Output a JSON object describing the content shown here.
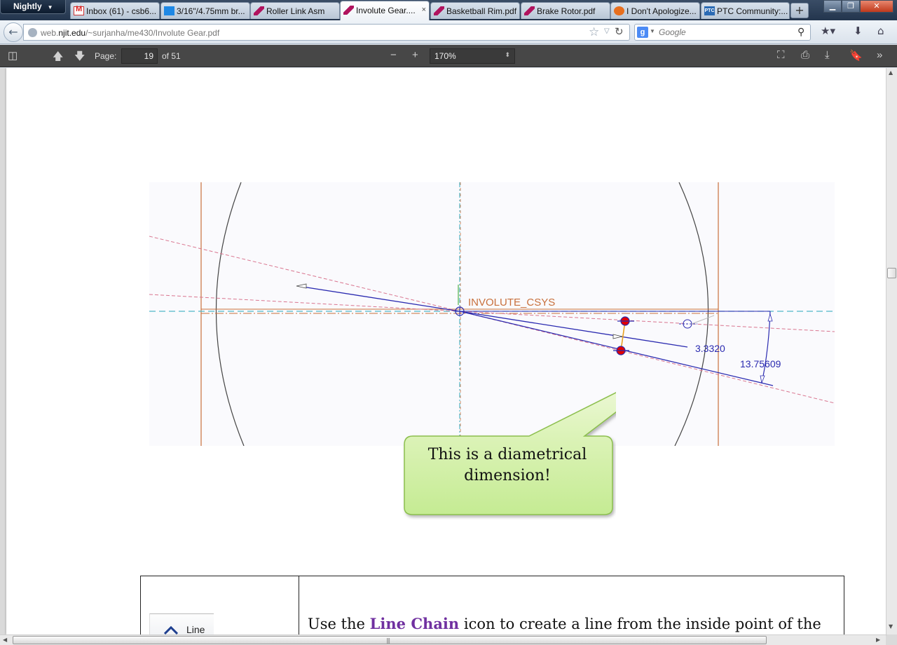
{
  "browser": {
    "app_button": "Nightly",
    "tabs": [
      {
        "label": "Inbox (61) - csb6...",
        "icon": "gmail-icon"
      },
      {
        "label": "3/16\"/4.75mm br...",
        "icon": "page-icon"
      },
      {
        "label": "Roller Link Asm",
        "icon": "pdf-icon"
      },
      {
        "label": "Involute Gear....",
        "icon": "pdf-icon",
        "active": true
      },
      {
        "label": "Basketball Rim.pdf",
        "icon": "pdf-icon"
      },
      {
        "label": "Brake Rotor.pdf",
        "icon": "pdf-icon"
      },
      {
        "label": "I Don't Apologize...",
        "icon": "rss-icon"
      },
      {
        "label": "PTC Community:...",
        "icon": "ptc-icon"
      }
    ],
    "tab_close_glyph": "×",
    "new_tab_glyph": "+",
    "ptc_fav_text": "PTC",
    "url_domain_prefix": "web.",
    "url_domain": "njit.edu",
    "url_path": "/~surjanha/me430/Involute Gear.pdf",
    "search_placeholder": "Google",
    "search_engine_letter": "g"
  },
  "pdf_toolbar": {
    "page_label": "Page:",
    "page_number": "19",
    "page_count": "of 51",
    "zoom": "170%"
  },
  "figure": {
    "csys_label": "INVOLUTE_CSYS",
    "dimension_diameter": "3.3320",
    "dimension_angle": "13.75609"
  },
  "callout": {
    "line1": "This is a diametrical",
    "line2": "dimension!"
  },
  "instruction": {
    "icon_label": "Line",
    "text_before": "Use the ",
    "highlight": "Line Chain",
    "text_after": " icon to create a line from the inside point of the"
  },
  "colors": {
    "construction_pink": "#d9758f",
    "sketch_blue": "#2a2ab0",
    "reference_orange": "#c8703c",
    "centerline_cyan": "#4fb7c9",
    "callout_green": "#c8ef9a"
  }
}
